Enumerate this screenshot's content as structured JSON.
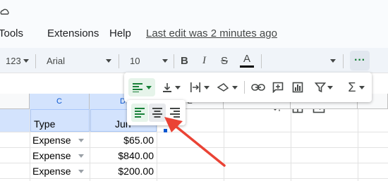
{
  "menu": {
    "items": [
      "Tools",
      "Extensions",
      "Help"
    ],
    "last_edit": "Last edit was 2 minutes ago"
  },
  "toolbar": {
    "number_format": "123",
    "font": "Arial",
    "font_size": "10"
  },
  "columns": {
    "c": "C",
    "d": "D",
    "e": "E"
  },
  "sheet": {
    "header": {
      "type": "Type",
      "month": "Jun"
    },
    "rows": [
      {
        "type": "Expense",
        "amount": "$65.00"
      },
      {
        "type": "Expense",
        "amount": "$840.00"
      },
      {
        "type": "Expense",
        "amount": "$200.00"
      }
    ]
  },
  "colors": {
    "accent": "#0b57d0",
    "selection": "#d3e3fd",
    "active_green": "#188038",
    "arrow": "#ea4335"
  }
}
